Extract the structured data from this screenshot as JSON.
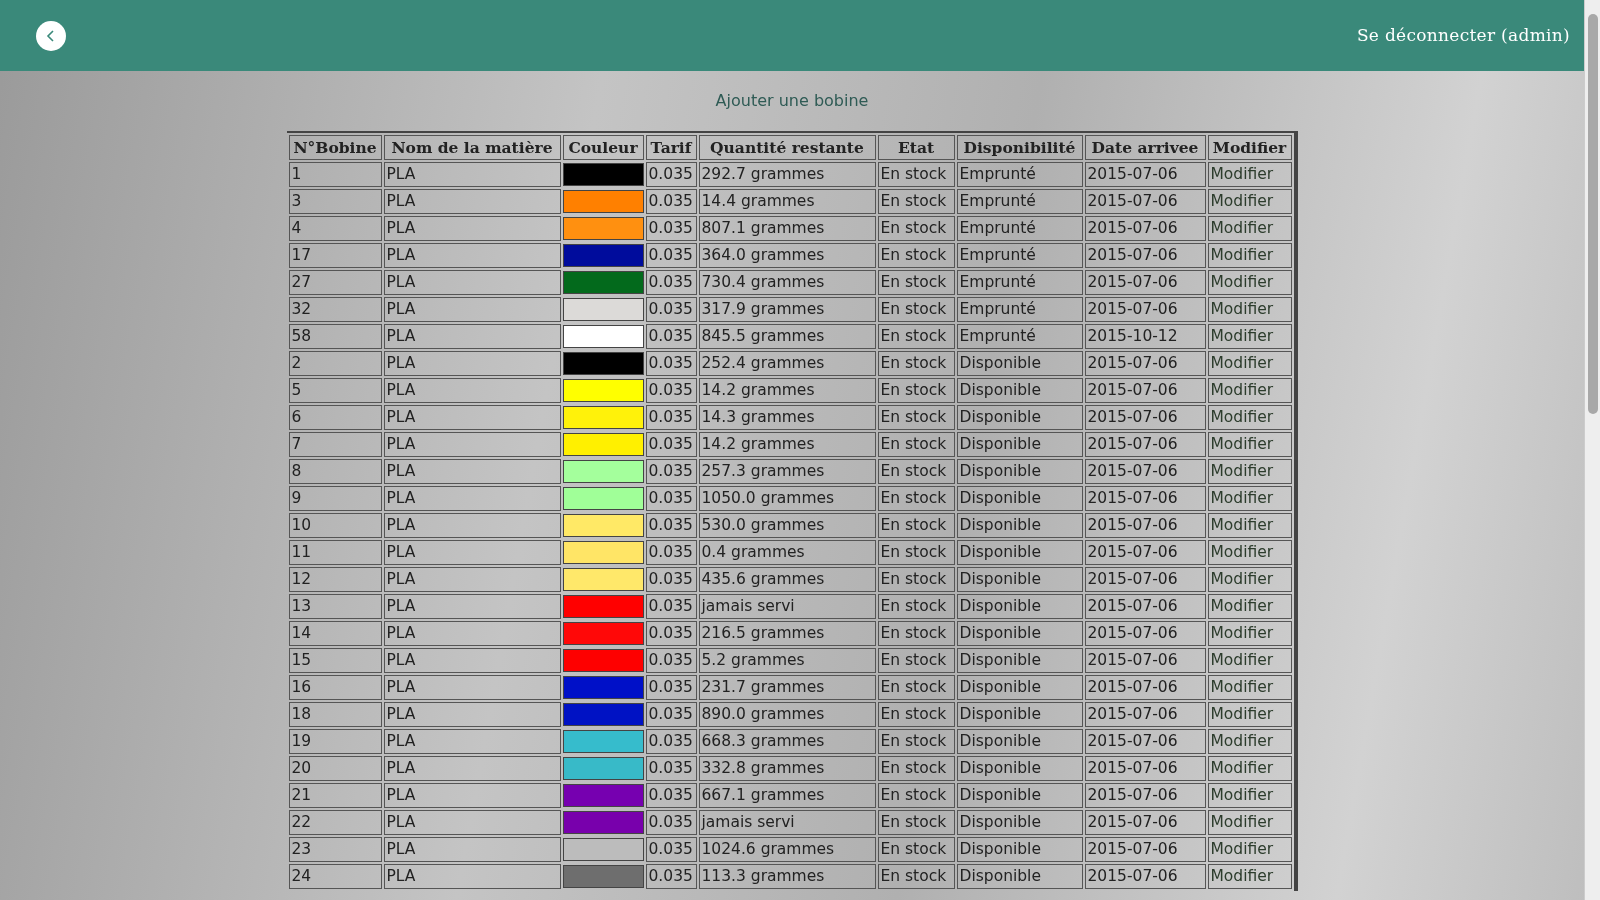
{
  "header": {
    "logout": "Se déconnecter (admin)"
  },
  "add_link": "Ajouter une bobine",
  "table": {
    "columns": [
      "N°Bobine",
      "Nom de la matière",
      "Couleur",
      "Tarif",
      "Quantité restante",
      "Etat",
      "Disponibilité",
      "Date arrivee",
      "Modifier"
    ],
    "rows": [
      {
        "id": "1",
        "material": "PLA",
        "color": "#000000",
        "rate": "0.035",
        "quantity": "292.7 grammes",
        "state": "En stock",
        "availability": "Emprunté",
        "date": "2015-07-06",
        "action": "Modifier"
      },
      {
        "id": "3",
        "material": "PLA",
        "color": "#ff8000",
        "rate": "0.035",
        "quantity": "14.4 grammes",
        "state": "En stock",
        "availability": "Emprunté",
        "date": "2015-07-06",
        "action": "Modifier"
      },
      {
        "id": "4",
        "material": "PLA",
        "color": "#ff9010",
        "rate": "0.035",
        "quantity": "807.1 grammes",
        "state": "En stock",
        "availability": "Emprunté",
        "date": "2015-07-06",
        "action": "Modifier"
      },
      {
        "id": "17",
        "material": "PLA",
        "color": "#000c9c",
        "rate": "0.035",
        "quantity": "364.0 grammes",
        "state": "En stock",
        "availability": "Emprunté",
        "date": "2015-07-06",
        "action": "Modifier"
      },
      {
        "id": "27",
        "material": "PLA",
        "color": "#036a1c",
        "rate": "0.035",
        "quantity": "730.4 grammes",
        "state": "En stock",
        "availability": "Emprunté",
        "date": "2015-07-06",
        "action": "Modifier"
      },
      {
        "id": "32",
        "material": "PLA",
        "color": "#dcdad8",
        "rate": "0.035",
        "quantity": "317.9 grammes",
        "state": "En stock",
        "availability": "Emprunté",
        "date": "2015-07-06",
        "action": "Modifier"
      },
      {
        "id": "58",
        "material": "PLA",
        "color": "#ffffff",
        "rate": "0.035",
        "quantity": "845.5 grammes",
        "state": "En stock",
        "availability": "Emprunté",
        "date": "2015-10-12",
        "action": "Modifier"
      },
      {
        "id": "2",
        "material": "PLA",
        "color": "#000000",
        "rate": "0.035",
        "quantity": "252.4 grammes",
        "state": "En stock",
        "availability": "Disponible",
        "date": "2015-07-06",
        "action": "Modifier"
      },
      {
        "id": "5",
        "material": "PLA",
        "color": "#ffff00",
        "rate": "0.035",
        "quantity": "14.2 grammes",
        "state": "En stock",
        "availability": "Disponible",
        "date": "2015-07-06",
        "action": "Modifier"
      },
      {
        "id": "6",
        "material": "PLA",
        "color": "#fff20a",
        "rate": "0.035",
        "quantity": "14.3 grammes",
        "state": "En stock",
        "availability": "Disponible",
        "date": "2015-07-06",
        "action": "Modifier"
      },
      {
        "id": "7",
        "material": "PLA",
        "color": "#fff000",
        "rate": "0.035",
        "quantity": "14.2 grammes",
        "state": "En stock",
        "availability": "Disponible",
        "date": "2015-07-06",
        "action": "Modifier"
      },
      {
        "id": "8",
        "material": "PLA",
        "color": "#a4ff9c",
        "rate": "0.035",
        "quantity": "257.3 grammes",
        "state": "En stock",
        "availability": "Disponible",
        "date": "2015-07-06",
        "action": "Modifier"
      },
      {
        "id": "9",
        "material": "PLA",
        "color": "#a0ff98",
        "rate": "0.035",
        "quantity": "1050.0 grammes",
        "state": "En stock",
        "availability": "Disponible",
        "date": "2015-07-06",
        "action": "Modifier"
      },
      {
        "id": "10",
        "material": "PLA",
        "color": "#ffe966",
        "rate": "0.035",
        "quantity": "530.0 grammes",
        "state": "En stock",
        "availability": "Disponible",
        "date": "2015-07-06",
        "action": "Modifier"
      },
      {
        "id": "11",
        "material": "PLA",
        "color": "#ffe566",
        "rate": "0.035",
        "quantity": "0.4 grammes",
        "state": "En stock",
        "availability": "Disponible",
        "date": "2015-07-06",
        "action": "Modifier"
      },
      {
        "id": "12",
        "material": "PLA",
        "color": "#ffe86a",
        "rate": "0.035",
        "quantity": "435.6 grammes",
        "state": "En stock",
        "availability": "Disponible",
        "date": "2015-07-06",
        "action": "Modifier"
      },
      {
        "id": "13",
        "material": "PLA",
        "color": "#ff0000",
        "rate": "0.035",
        "quantity": "jamais servi",
        "state": "En stock",
        "availability": "Disponible",
        "date": "2015-07-06",
        "action": "Modifier"
      },
      {
        "id": "14",
        "material": "PLA",
        "color": "#ff0808",
        "rate": "0.035",
        "quantity": "216.5 grammes",
        "state": "En stock",
        "availability": "Disponible",
        "date": "2015-07-06",
        "action": "Modifier"
      },
      {
        "id": "15",
        "material": "PLA",
        "color": "#fe0000",
        "rate": "0.035",
        "quantity": "5.2 grammes",
        "state": "En stock",
        "availability": "Disponible",
        "date": "2015-07-06",
        "action": "Modifier"
      },
      {
        "id": "16",
        "material": "PLA",
        "color": "#0010c8",
        "rate": "0.035",
        "quantity": "231.7 grammes",
        "state": "En stock",
        "availability": "Disponible",
        "date": "2015-07-06",
        "action": "Modifier"
      },
      {
        "id": "18",
        "material": "PLA",
        "color": "#0012c4",
        "rate": "0.035",
        "quantity": "890.0 grammes",
        "state": "En stock",
        "availability": "Disponible",
        "date": "2015-07-06",
        "action": "Modifier"
      },
      {
        "id": "19",
        "material": "PLA",
        "color": "#36bccc",
        "rate": "0.035",
        "quantity": "668.3 grammes",
        "state": "En stock",
        "availability": "Disponible",
        "date": "2015-07-06",
        "action": "Modifier"
      },
      {
        "id": "20",
        "material": "PLA",
        "color": "#38bac8",
        "rate": "0.035",
        "quantity": "332.8 grammes",
        "state": "En stock",
        "availability": "Disponible",
        "date": "2015-07-06",
        "action": "Modifier"
      },
      {
        "id": "21",
        "material": "PLA",
        "color": "#7600b0",
        "rate": "0.035",
        "quantity": "667.1 grammes",
        "state": "En stock",
        "availability": "Disponible",
        "date": "2015-07-06",
        "action": "Modifier"
      },
      {
        "id": "22",
        "material": "PLA",
        "color": "#7800ac",
        "rate": "0.035",
        "quantity": "jamais servi",
        "state": "En stock",
        "availability": "Disponible",
        "date": "2015-07-06",
        "action": "Modifier"
      },
      {
        "id": "23",
        "material": "PLA",
        "color": "#bcbcbc",
        "rate": "0.035",
        "quantity": "1024.6 grammes",
        "state": "En stock",
        "availability": "Disponible",
        "date": "2015-07-06",
        "action": "Modifier"
      },
      {
        "id": "24",
        "material": "PLA",
        "color": "#6e6e6e",
        "rate": "0.035",
        "quantity": "113.3 grammes",
        "state": "En stock",
        "availability": "Disponible",
        "date": "2015-07-06",
        "action": "Modifier"
      }
    ]
  }
}
